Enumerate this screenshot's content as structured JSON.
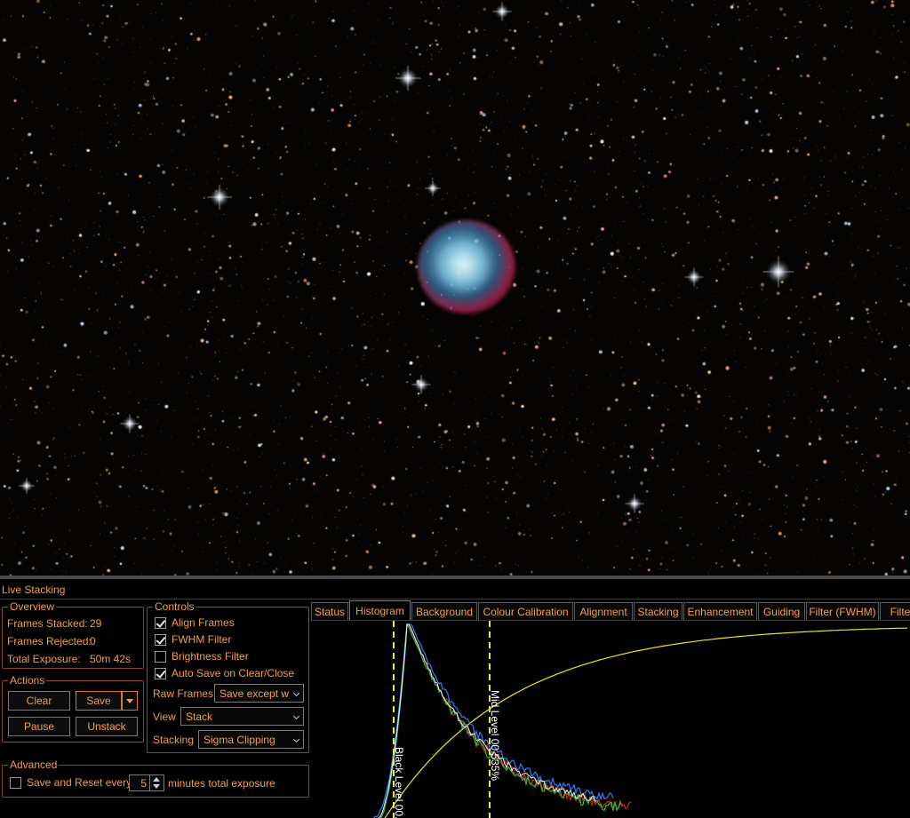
{
  "panel": {
    "title": "Live Stacking"
  },
  "overview": {
    "legend": "Overview",
    "frames_stacked_label": "Frames Stacked:",
    "frames_stacked_value": "29",
    "frames_rejected_label": "Frames Rejected:",
    "frames_rejected_value": "0",
    "total_exposure_label": "Total Exposure:",
    "total_exposure_value": "50m 42s"
  },
  "actions": {
    "legend": "Actions",
    "clear": "Clear",
    "save": "Save",
    "pause": "Pause",
    "unstack": "Unstack"
  },
  "controls": {
    "legend": "Controls",
    "align_frames": {
      "label": "Align Frames",
      "checked": true
    },
    "fwhm_filter": {
      "label": "FWHM Filter",
      "checked": true
    },
    "brightness_filter": {
      "label": "Brightness Filter",
      "checked": false
    },
    "auto_save": {
      "label": "Auto Save on Clear/Close",
      "checked": true
    },
    "raw_frames_label": "Raw Frames",
    "raw_frames_value": "Save except w",
    "view_label": "View",
    "view_value": "Stack",
    "stacking_label": "Stacking",
    "stacking_value": "Sigma Clipping"
  },
  "advanced": {
    "legend": "Advanced",
    "save_reset": {
      "label": "Save and Reset every",
      "checked": false
    },
    "minutes_value": "5",
    "suffix": "minutes total exposure"
  },
  "tabs": [
    {
      "label": "Status"
    },
    {
      "label": "Histogram",
      "active": true
    },
    {
      "label": "Background"
    },
    {
      "label": "Colour Calibration"
    },
    {
      "label": "Alignment"
    },
    {
      "label": "Stacking"
    },
    {
      "label": "Enhancement"
    },
    {
      "label": "Guiding"
    },
    {
      "label": "Filter (FWHM)"
    },
    {
      "label": "Filter"
    }
  ],
  "histogram": {
    "black_level_label": "Black Level  00.",
    "mid_level_label": "Mid Level  00.535%",
    "colors": {
      "red": "#e02020",
      "green": "#20c040",
      "blue": "#2f7fff",
      "white": "#f0f0f0",
      "curve": "#e8e820",
      "marker": "#f0f020"
    }
  },
  "colors": {
    "accent": "#f0a040",
    "border": "#8a4a1a"
  }
}
